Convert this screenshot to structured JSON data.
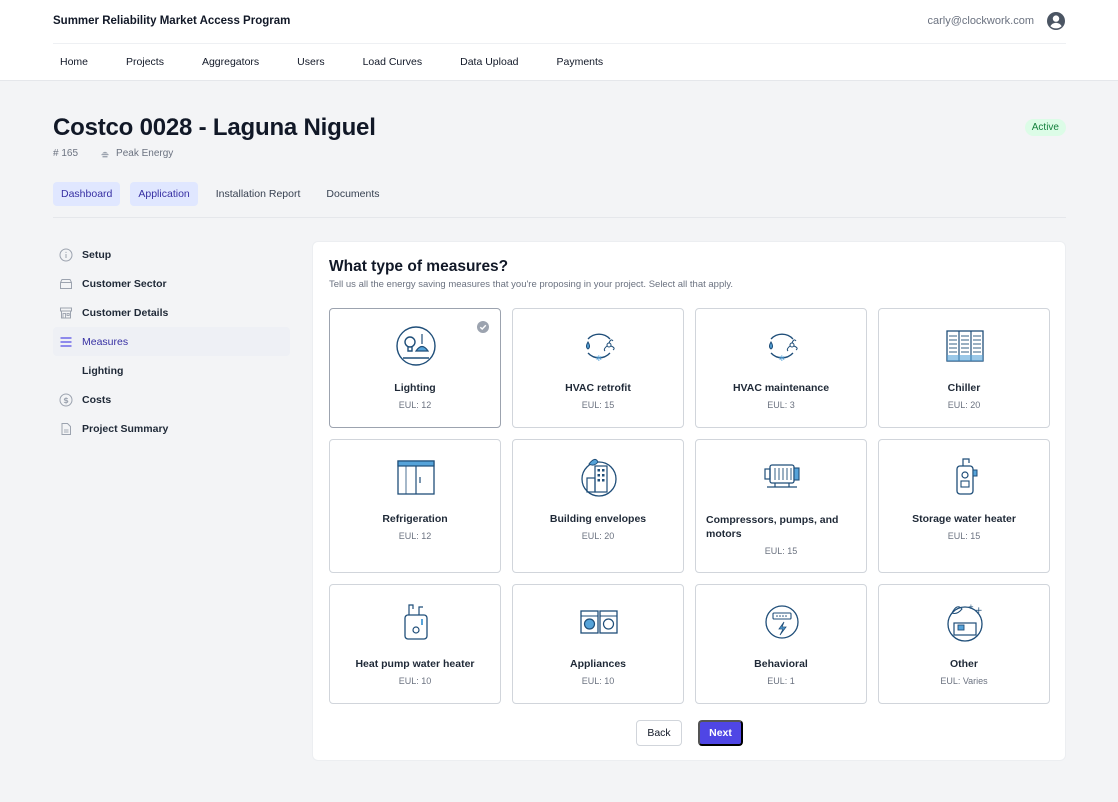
{
  "app": {
    "title": "Summer Reliability Market Access Program",
    "user_email": "carly@clockwork.com"
  },
  "nav": {
    "items": [
      "Home",
      "Projects",
      "Aggregators",
      "Users",
      "Load Curves",
      "Data Upload",
      "Payments"
    ]
  },
  "project": {
    "title": "Costco 0028 - Laguna Niguel",
    "status": "Active",
    "id_label": "# 165",
    "aggregator": "Peak Energy"
  },
  "tabs": [
    {
      "label": "Dashboard",
      "active": true
    },
    {
      "label": "Application",
      "active": true
    },
    {
      "label": "Installation Report",
      "active": false
    },
    {
      "label": "Documents",
      "active": false
    }
  ],
  "sidebar": {
    "items": [
      {
        "label": "Setup",
        "icon": "info-icon"
      },
      {
        "label": "Customer Sector",
        "icon": "folder-icon"
      },
      {
        "label": "Customer Details",
        "icon": "storefront-icon"
      },
      {
        "label": "Measures",
        "icon": "list-icon",
        "active": true
      },
      {
        "label": "Lighting",
        "sub": true
      },
      {
        "label": "Costs",
        "icon": "dollar-icon"
      },
      {
        "label": "Project Summary",
        "icon": "document-icon"
      }
    ]
  },
  "measures": {
    "title": "What type of measures?",
    "subtitle": "Tell us all the energy saving measures that you're proposing in your project. Select all that apply.",
    "tiles": [
      {
        "label": "Lighting",
        "eul": "EUL: 12",
        "icon": "lighting-icon",
        "selected": true
      },
      {
        "label": "HVAC retrofit",
        "eul": "EUL: 15",
        "icon": "hvac-retrofit-icon"
      },
      {
        "label": "HVAC maintenance",
        "eul": "EUL: 3",
        "icon": "hvac-maintenance-icon"
      },
      {
        "label": "Chiller",
        "eul": "EUL: 20",
        "icon": "chiller-icon"
      },
      {
        "label": "Refrigeration",
        "eul": "EUL: 12",
        "icon": "refrigeration-icon"
      },
      {
        "label": "Building envelopes",
        "eul": "EUL: 20",
        "icon": "building-envelope-icon"
      },
      {
        "label": "Compressors, pumps, and motors",
        "eul": "EUL: 15",
        "icon": "compressor-icon"
      },
      {
        "label": "Storage water heater",
        "eul": "EUL: 15",
        "icon": "storage-water-heater-icon"
      },
      {
        "label": "Heat pump water heater",
        "eul": "EUL: 10",
        "icon": "heat-pump-water-heater-icon"
      },
      {
        "label": "Appliances",
        "eul": "EUL: 10",
        "icon": "appliances-icon"
      },
      {
        "label": "Behavioral",
        "eul": "EUL: 1",
        "icon": "behavioral-meter-icon"
      },
      {
        "label": "Other",
        "eul": "EUL: Varies",
        "icon": "other-box-icon"
      }
    ],
    "back_label": "Back",
    "next_label": "Next"
  },
  "colors": {
    "accent": "#4f46e5",
    "icon_stroke": "#1f4e79",
    "icon_accent": "#56a3d9",
    "active_badge_bg": "#dcfce7",
    "active_badge_text": "#15803d"
  }
}
